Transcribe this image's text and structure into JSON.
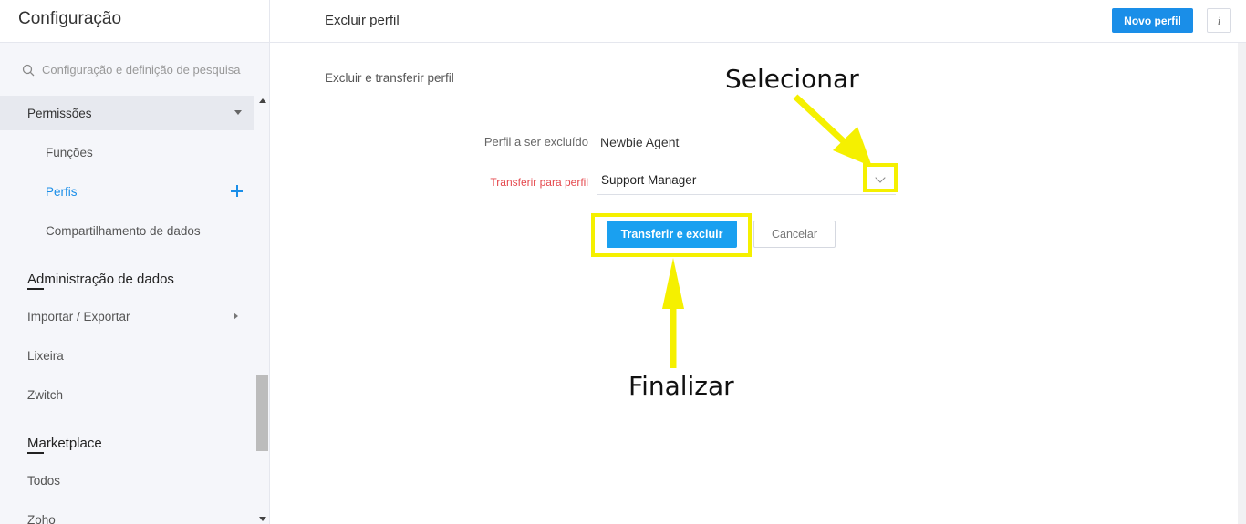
{
  "sidebar": {
    "title": "Configuração",
    "search_placeholder": "Configuração e definição de pesquisa",
    "items": {
      "permissoes": "Permissões",
      "funcoes": "Funções",
      "perfis": "Perfis",
      "compartilhamento": "Compartilhamento de dados",
      "importar_exportar": "Importar / Exportar",
      "lixeira": "Lixeira",
      "zwitch": "Zwitch",
      "todos": "Todos",
      "zoho": "Zoho"
    },
    "sections": {
      "admin_dados": "Administração de dados",
      "marketplace": "Marketplace"
    }
  },
  "header": {
    "title": "Excluir perfil",
    "new_profile_button": "Novo perfil",
    "info_icon_glyph": "i"
  },
  "form": {
    "section_title": "Excluir e transferir perfil",
    "profile_to_delete_label": "Perfil a ser excluído",
    "profile_to_delete_value": "Newbie Agent",
    "transfer_to_label": "Transferir para perfil",
    "transfer_to_value": "Support Manager",
    "transfer_button": "Transferir e excluir",
    "cancel_button": "Cancelar"
  },
  "annotations": {
    "select_label": "Selecionar",
    "finish_label": "Finalizar",
    "color": "#f5f000"
  },
  "colors": {
    "primary": "#1a8ee8",
    "required": "#e5484d",
    "sidebar_bg": "#f5f6fa"
  }
}
